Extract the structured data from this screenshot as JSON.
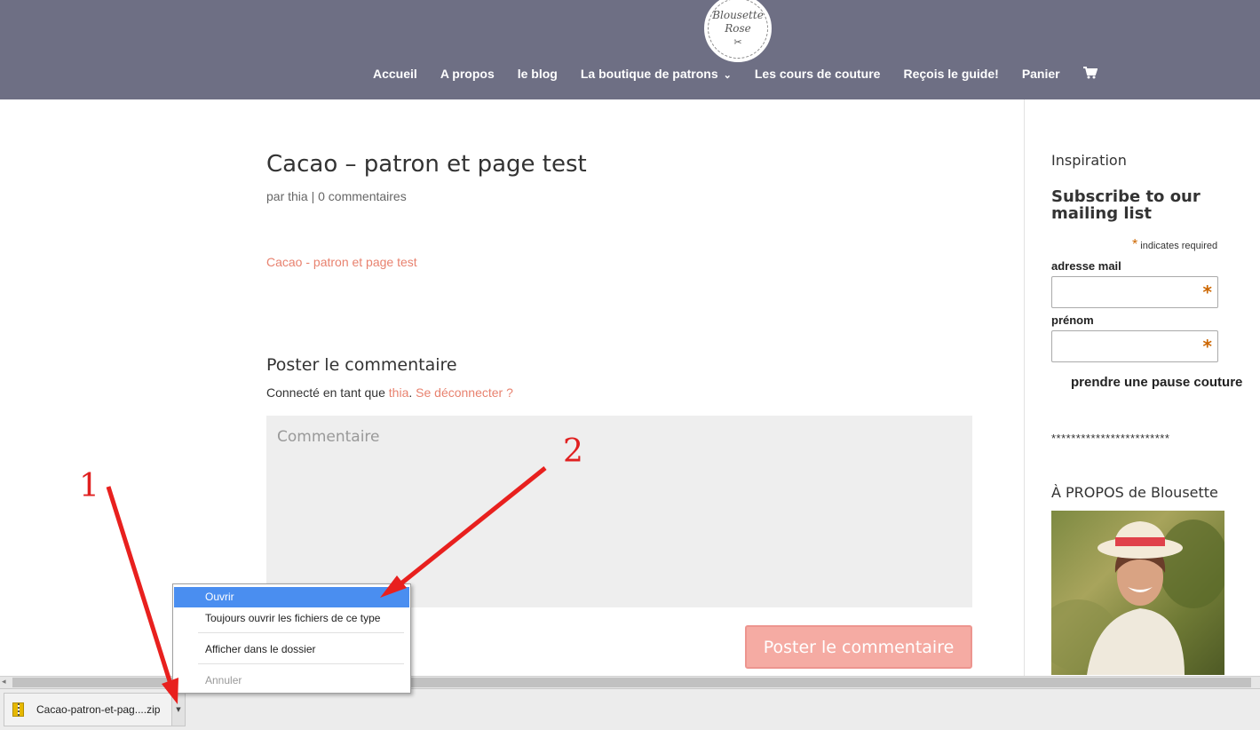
{
  "header": {
    "logo_line1": "Blousette",
    "logo_line2": "Rose",
    "nav": [
      {
        "label": "Accueil"
      },
      {
        "label": "A propos"
      },
      {
        "label": "le blog"
      },
      {
        "label": "La boutique de patrons"
      },
      {
        "label": "Les cours de couture"
      },
      {
        "label": "Reçois le guide!"
      },
      {
        "label": "Panier"
      }
    ]
  },
  "post": {
    "title": "Cacao – patron et page test",
    "meta_prefix": "par",
    "author": "thia",
    "comments_link": "0 commentaires",
    "file_link": "Cacao - patron et page test"
  },
  "comment_form": {
    "heading": "Poster le commentaire",
    "logged_in_prefix": "Connecté en tant que",
    "user": "thia",
    "logout": "Se déconnecter ?",
    "placeholder": "Commentaire",
    "submit": "Poster le commentaire"
  },
  "sidebar": {
    "inspiration": "Inspiration",
    "subscribe_title": "Subscribe to our mailing list",
    "required_note": "indicates required",
    "email_label": "adresse mail",
    "firstname_label": "prénom",
    "pause_text": "prendre une pause couture",
    "stars_line": "************************",
    "about_title": "À PROPOS de Blousette"
  },
  "download_bar": {
    "filename": "Cacao-patron-et-pag....zip"
  },
  "context_menu": {
    "items": [
      {
        "label": "Ouvrir"
      },
      {
        "label": "Toujours ouvrir les fichiers de ce type"
      },
      {
        "label": "Afficher dans le dossier"
      },
      {
        "label": "Annuler"
      }
    ]
  },
  "annotations": {
    "step1": "1",
    "step2": "2"
  },
  "colors": {
    "header_bg": "#6e6f84",
    "accent_pink": "#e8826f",
    "button_pink": "#f5a39a",
    "menu_highlight": "#4a8ef0",
    "annotation_red": "#e02020"
  }
}
